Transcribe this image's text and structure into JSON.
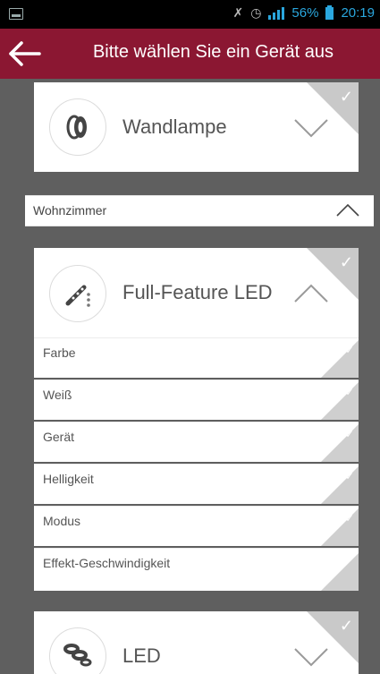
{
  "statusbar": {
    "battery_percent": "56%",
    "time": "20:19",
    "icons": [
      "image-icon",
      "mute-icon",
      "alarm-icon",
      "signal-icon",
      "battery-icon"
    ]
  },
  "header": {
    "title": "Bitte wählen Sie ein Gerät aus",
    "back_icon": "arrow-left-icon",
    "color": "#8b1732"
  },
  "devices": [
    {
      "name": "Wandlampe",
      "icon": "wall-lamp-icon",
      "expanded": false
    },
    {
      "name": "Full-Feature LED",
      "icon": "led-strip-icon",
      "expanded": true
    },
    {
      "name": "LED",
      "icon": "led-dots-icon",
      "expanded": false
    }
  ],
  "room": {
    "label": "Wohnzimmer",
    "expanded": true
  },
  "features": [
    {
      "label": "Farbe"
    },
    {
      "label": "Weiß"
    },
    {
      "label": "Gerät"
    },
    {
      "label": "Helligkeit"
    },
    {
      "label": "Modus"
    },
    {
      "label": "Effekt-Geschwindigkeit"
    }
  ],
  "check_glyph": "✓",
  "colors": {
    "accent": "#8b1732",
    "status_blue": "#2aa7de",
    "background": "#5f5f5f",
    "corner_gray": "#c9c9c9"
  }
}
